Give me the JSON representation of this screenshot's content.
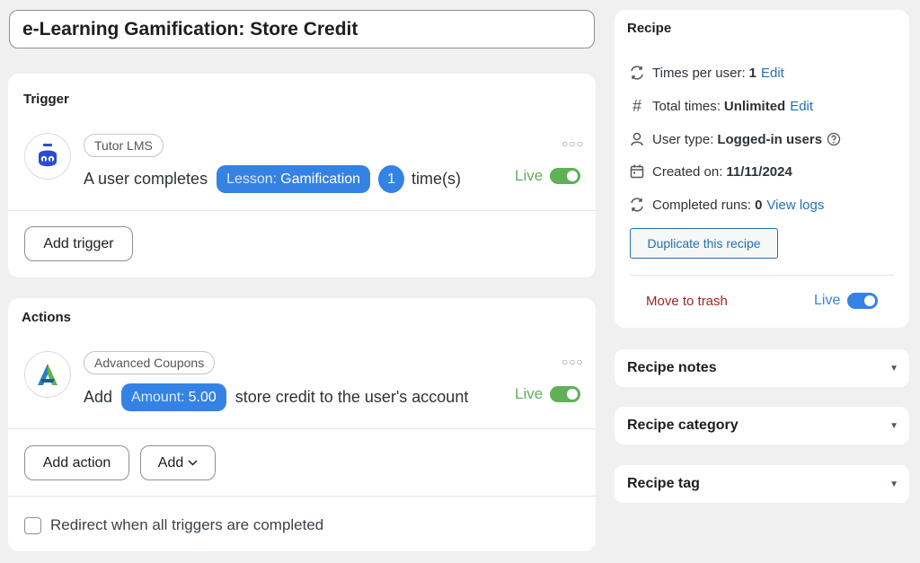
{
  "recipe_title": "e-Learning Gamification: Store Credit",
  "colors": {
    "accent": "#3582e5",
    "live_green": "#5fb157",
    "link": "#2271b1",
    "danger": "#a02525"
  },
  "trigger": {
    "section_title": "Trigger",
    "integration": "Tutor LMS",
    "icon": "tutor-lms-logo",
    "sentence_prefix": "A user completes",
    "token_key": "Lesson:",
    "token_value": "Gamification",
    "count": "1",
    "sentence_suffix": "time(s)",
    "live_label": "Live",
    "add_button": "Add trigger"
  },
  "actions": {
    "section_title": "Actions",
    "integration": "Advanced Coupons",
    "icon": "advanced-coupons-logo",
    "sentence_prefix": "Add",
    "token_key": "Amount:",
    "token_value": "5.00",
    "sentence_suffix": "store credit to the user's account",
    "live_label": "Live",
    "add_action_button": "Add action",
    "add_button": "Add",
    "redirect_label": "Redirect when all triggers are completed"
  },
  "sidebar": {
    "title": "Recipe",
    "times_per_user_label": "Times per user:",
    "times_per_user_value": "1",
    "times_per_user_edit": "Edit",
    "total_times_label": "Total times:",
    "total_times_value": "Unlimited",
    "total_times_edit": "Edit",
    "user_type_label": "User type:",
    "user_type_value": "Logged-in users",
    "created_on_label": "Created on:",
    "created_on_value": "11/11/2024",
    "completed_runs_label": "Completed runs:",
    "completed_runs_value": "0",
    "view_logs": "View logs",
    "duplicate_button": "Duplicate this recipe",
    "trash_link": "Move to trash",
    "live_label": "Live",
    "notes": "Recipe notes",
    "category": "Recipe category",
    "tag": "Recipe tag"
  }
}
